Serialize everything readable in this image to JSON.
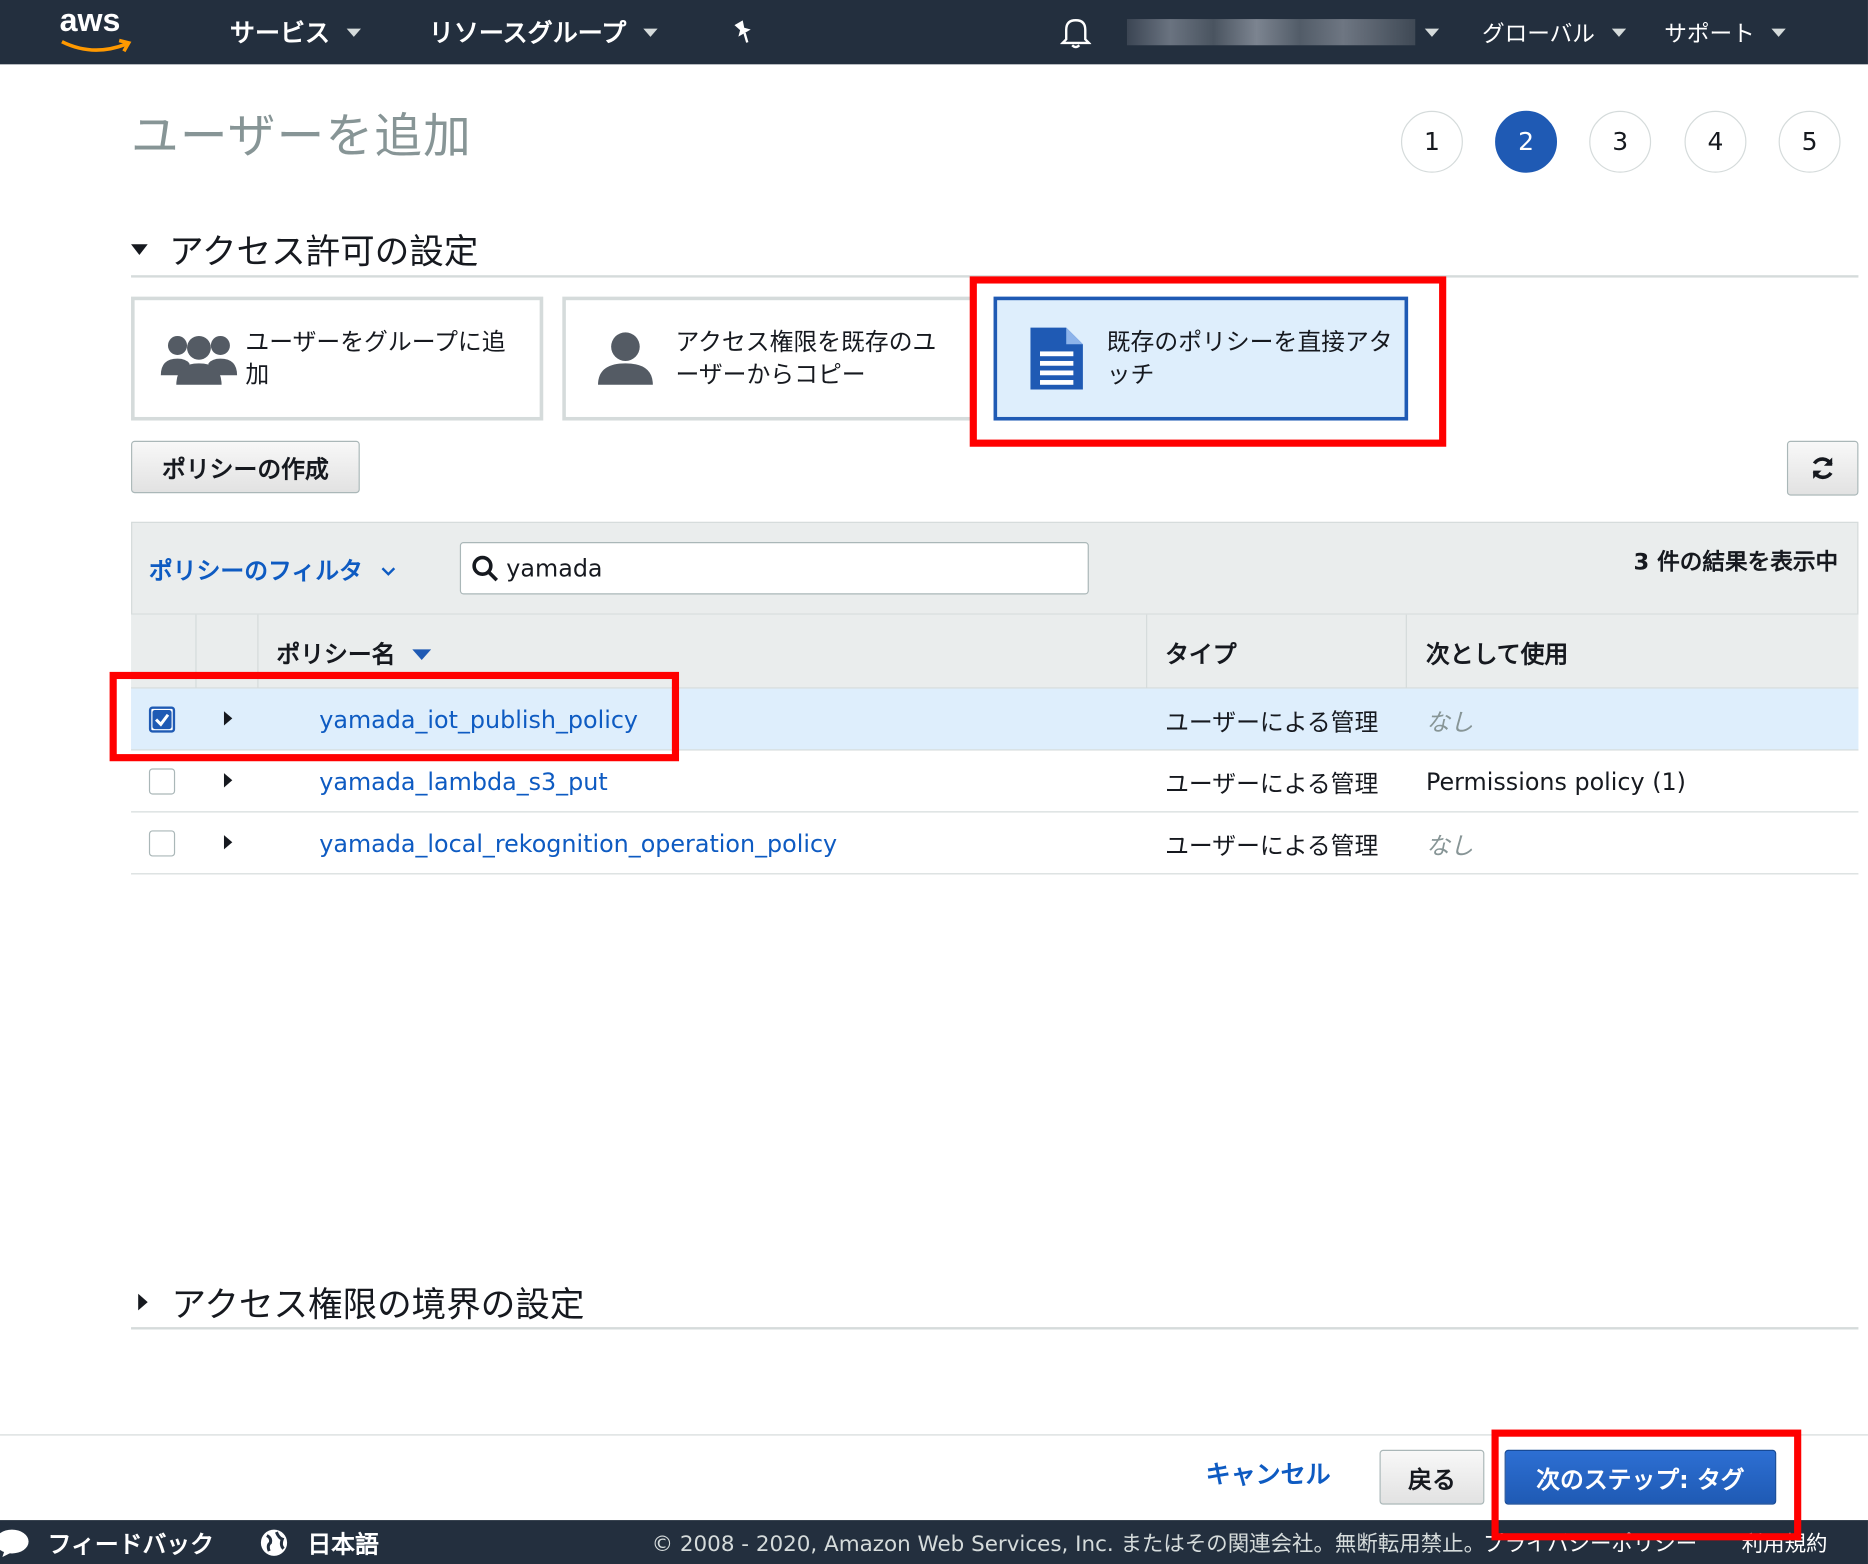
{
  "nav": {
    "logo": "aws",
    "services": "サービス",
    "resource_groups": "リソースグループ",
    "region": "グローバル",
    "support": "サポート"
  },
  "header": {
    "title": "ユーザーを追加",
    "steps": [
      "1",
      "2",
      "3",
      "4",
      "5"
    ],
    "active_step": "2"
  },
  "permissions": {
    "section_title": "アクセス許可の設定",
    "options": [
      {
        "label": "ユーザーをグループに追加",
        "icon": "users-group-icon",
        "selected": false
      },
      {
        "label": "アクセス権限を既存のユーザーからコピー",
        "icon": "user-icon",
        "selected": false
      },
      {
        "label": "既存のポリシーを直接アタッチ",
        "icon": "document-icon",
        "selected": true
      }
    ],
    "create_policy_label": "ポリシーの作成",
    "refresh_icon": "refresh-icon"
  },
  "filter": {
    "label": "ポリシーのフィルタ",
    "search_value": "yamada",
    "result_count": "3 件の結果を表示中"
  },
  "table": {
    "columns": {
      "name": "ポリシー名",
      "type": "タイプ",
      "used_as": "次として使用"
    },
    "rows": [
      {
        "name": "yamada_iot_publish_policy",
        "type": "ユーザーによる管理",
        "used_as": "なし",
        "checked": true
      },
      {
        "name": "yamada_lambda_s3_put",
        "type": "ユーザーによる管理",
        "used_as": "Permissions policy (1)",
        "checked": false
      },
      {
        "name": "yamada_local_rekognition_operation_policy",
        "type": "ユーザーによる管理",
        "used_as": "なし",
        "checked": false
      }
    ]
  },
  "boundary": {
    "section_title": "アクセス権限の境界の設定"
  },
  "actions": {
    "cancel": "キャンセル",
    "back": "戻る",
    "next": "次のステップ: タグ"
  },
  "footer": {
    "feedback": "フィードバック",
    "language": "日本語",
    "copyright": "© 2008 - 2020, Amazon Web Services, Inc. またはその関連会社。無断転用禁止。",
    "privacy": "プライバシーポリシー",
    "terms": "利用規約"
  },
  "colors": {
    "nav_bg": "#232f3e",
    "primary": "#1f5ab4",
    "link": "#0e5bc2",
    "selected_bg": "#deeefc",
    "annotation_red": "#ff0000",
    "aws_orange": "#ff9900"
  }
}
